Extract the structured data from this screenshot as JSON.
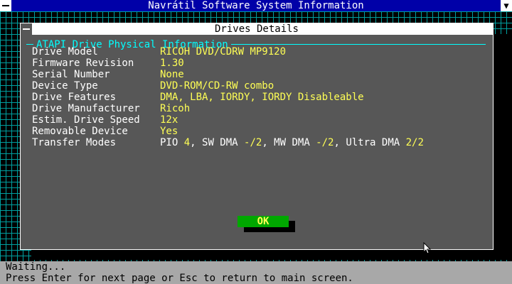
{
  "titlebar": {
    "title": "Navrátil Software System Information"
  },
  "dialog": {
    "title": "Drives Details",
    "group_title": "ATAPI Drive Physical Information",
    "rows": [
      {
        "label": "Drive Model",
        "value": "RICOH DVD/CDRW MP9120"
      },
      {
        "label": "Firmware Revision",
        "value": "1.30"
      },
      {
        "label": "Serial Number",
        "value": "None"
      },
      {
        "label": "Device Type",
        "value": "DVD-ROM/CD-RW combo"
      },
      {
        "label": "Drive Features",
        "value": "DMA, LBA, IORDY, IORDY Disableable"
      },
      {
        "label": "Drive Manufacturer",
        "value": "Ricoh"
      },
      {
        "label": "Estim. Drive Speed",
        "value": "12x"
      },
      {
        "label": "Removable Device",
        "value": "Yes"
      }
    ],
    "transfer": {
      "label": "Transfer Modes",
      "pio_prefix": "PIO ",
      "pio_value": "4",
      "sw_prefix": ", SW DMA ",
      "sw_value": "-/2",
      "mw_prefix": ", MW DMA ",
      "mw_value": "-/2",
      "udma_prefix": ", Ultra DMA ",
      "udma_value": "2/2"
    },
    "ok_label": "OK"
  },
  "status": {
    "line1": "Waiting...",
    "line2": "Press Enter for next page or Esc to return to main screen."
  },
  "colors": {
    "title_bg": "#0000a8",
    "dialog_bg": "#575757",
    "label": "#ffffff",
    "value": "#ffff55",
    "group": "#00ffff",
    "button": "#00a800",
    "desktop_grid": "#00a0a0",
    "status_bg": "#a8a8a8"
  }
}
